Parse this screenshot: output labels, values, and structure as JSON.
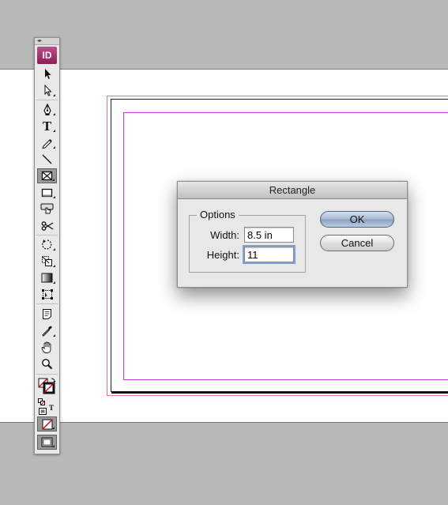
{
  "app": {
    "logo_text": "ID",
    "panel_grip": "◂▸"
  },
  "tools": [
    {
      "name": "selection-tool",
      "icon": "black-arrow-icon",
      "selected": false
    },
    {
      "name": "direct-selection-tool",
      "icon": "white-arrow-icon",
      "selected": false
    },
    {
      "name": "pen-tool",
      "icon": "pen-icon",
      "selected": false
    },
    {
      "name": "type-tool",
      "icon": "type-icon",
      "glyph": "T",
      "selected": false
    },
    {
      "name": "pencil-tool",
      "icon": "pencil-icon",
      "selected": false
    },
    {
      "name": "line-tool",
      "icon": "line-icon",
      "selected": false
    },
    {
      "name": "rectangle-frame-tool",
      "icon": "rectangle-frame-icon",
      "selected": true
    },
    {
      "name": "rectangle-tool",
      "icon": "rectangle-icon",
      "selected": false
    },
    {
      "name": "button-tool",
      "icon": "button-hand-icon",
      "selected": false
    },
    {
      "name": "scissors-tool",
      "icon": "scissors-icon",
      "selected": false
    },
    {
      "name": "rotate-tool",
      "icon": "rotate-icon",
      "selected": false
    },
    {
      "name": "scale-tool",
      "icon": "scale-icon",
      "selected": false
    },
    {
      "name": "gradient-tool",
      "icon": "gradient-icon",
      "selected": false
    },
    {
      "name": "free-transform-tool",
      "icon": "free-transform-icon",
      "selected": false
    },
    {
      "name": "note-tool",
      "icon": "note-icon",
      "selected": false
    },
    {
      "name": "eyedropper-tool",
      "icon": "eyedropper-icon",
      "selected": false
    },
    {
      "name": "hand-tool",
      "icon": "hand-icon",
      "selected": false
    },
    {
      "name": "zoom-tool",
      "icon": "magnifier-icon",
      "selected": false
    }
  ],
  "dialog": {
    "title": "Rectangle",
    "group_label": "Options",
    "width_label": "Width:",
    "width_value": "8.5 in",
    "height_label": "Height:",
    "height_value": "11",
    "ok_label": "OK",
    "cancel_label": "Cancel"
  },
  "colors": {
    "margin_guide": "#c53bd6",
    "bleed_guide": "#e0758c",
    "logo_gradient_top": "#c64c87",
    "logo_gradient_bottom": "#8c1f57",
    "default_button": "#a4b6cc"
  }
}
